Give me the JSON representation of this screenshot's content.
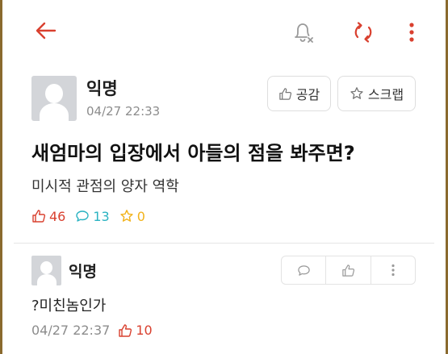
{
  "header": {
    "back_icon": "arrow-left-icon",
    "bell_icon": "bell-off-icon",
    "refresh_icon": "refresh-icon",
    "more_icon": "more-vertical-icon",
    "accent_color": "#d9402f"
  },
  "post": {
    "author": "익명",
    "time": "04/27 22:33",
    "like_button_label": "공감",
    "scrap_button_label": "스크랩",
    "title": "새엄마의 입장에서 아들의 점을 봐주면?",
    "body": "미시적 관점의 양자 역학",
    "stats": {
      "likes": "46",
      "comments": "13",
      "scraps": "0",
      "like_color": "#d9402f",
      "comment_color": "#2bb3c2",
      "scrap_color": "#f2b31b"
    }
  },
  "comment": {
    "author": "익명",
    "text": "?미친놈인가",
    "time": "04/27 22:37",
    "likes": "10"
  }
}
